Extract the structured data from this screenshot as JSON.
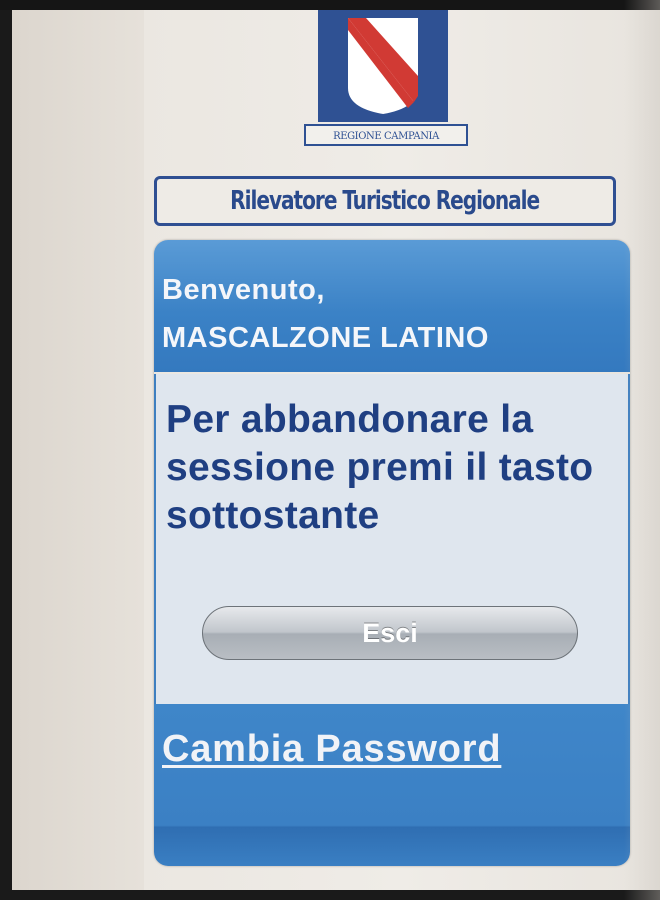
{
  "logo": {
    "label": "REGIONE CAMPANIA",
    "colors": {
      "blue": "#2f5193",
      "red": "#d13a34"
    }
  },
  "banner": {
    "title": "Rilevatore Turistico Regionale"
  },
  "welcome": {
    "greeting": "Benvenuto,",
    "user_name": "MASCALZONE LATINO"
  },
  "session": {
    "message": "Per abbandonare la sessione premi il tasto sottostante",
    "exit_label": "Esci"
  },
  "footer": {
    "change_password_label": "Cambia Password"
  },
  "theme": {
    "accent_blue": "#3b82c6",
    "text_dark_blue": "#1f3f82",
    "panel_bg": "#dfe6ee"
  }
}
